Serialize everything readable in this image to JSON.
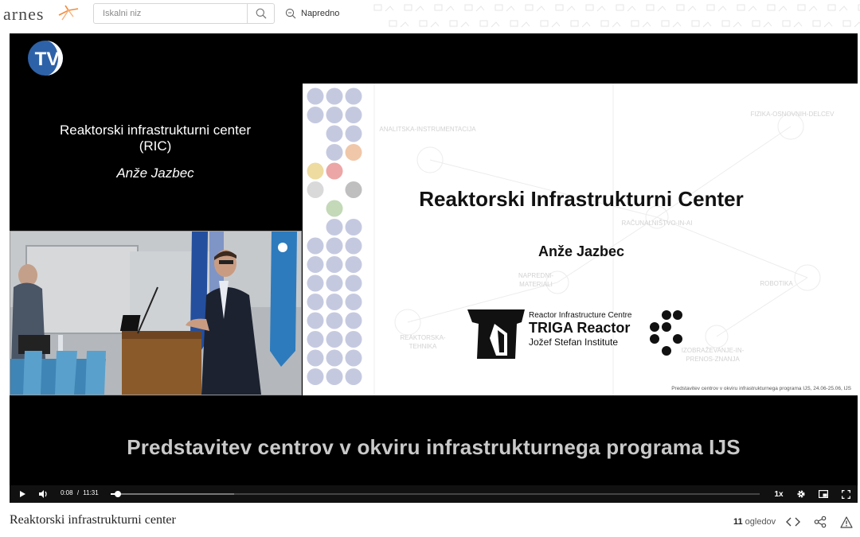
{
  "header": {
    "logo": "arnes",
    "search_placeholder": "Iskalni niz",
    "advanced_label": "Napredno"
  },
  "player": {
    "tv_logo": "TV",
    "talk_title_line1": "Reaktorski infrastrukturni center",
    "talk_title_line2": "(RIC)",
    "talk_speaker": "Anže Jazbec",
    "slide": {
      "title": "Reaktorski Infrastrukturni Center",
      "speaker": "Anže Jazbec",
      "triga_line1": "Reactor Infrastructure Centre",
      "triga_line2": "TRIGA Reactor",
      "triga_line3": "Jožef Stefan Institute",
      "footer": "Predstavitev centrov v okviru infrastrukturnega programa IJS, 24.06-25.06, IJS",
      "watermarks": [
        "ANALITSKA-INSTRUMENTACIJA",
        "FIZIKA-OSNOVNIH-DELCEV",
        "RAČUNALNIŠTVO-IN-AI",
        "NAPREDNI-MATERIALI",
        "ROBOTIKA",
        "REAKTORSKA-TEHNIKA",
        "IZOBRAŽEVANJE-IN-PRENOS-ZNANJA"
      ]
    },
    "banner": "Predstavitev centrov v okviru infrastrukturnega programa IJS",
    "controls": {
      "current_time": "0:08",
      "separator": "/",
      "duration": "11:31",
      "progress_fraction": 0.0116,
      "buffered_fraction": 0.19,
      "speed": "1x"
    }
  },
  "video": {
    "title": "Reaktorski infrastrukturni center",
    "views_count": "11",
    "views_label": "ogledov"
  },
  "icons": {
    "search": "search-icon",
    "advanced": "advanced-search-icon",
    "play": "play-icon",
    "volume": "volume-icon",
    "settings": "gear-icon",
    "pip": "picture-in-picture-icon",
    "fullscreen": "fullscreen-icon",
    "embed": "embed-code-icon",
    "share": "share-icon",
    "report": "warning-icon"
  },
  "colors": {
    "player_bg": "#000000",
    "banner_text": "#c9c9c9",
    "logo_accent": "#f28c3b",
    "tv_blue": "#2e62a8"
  }
}
